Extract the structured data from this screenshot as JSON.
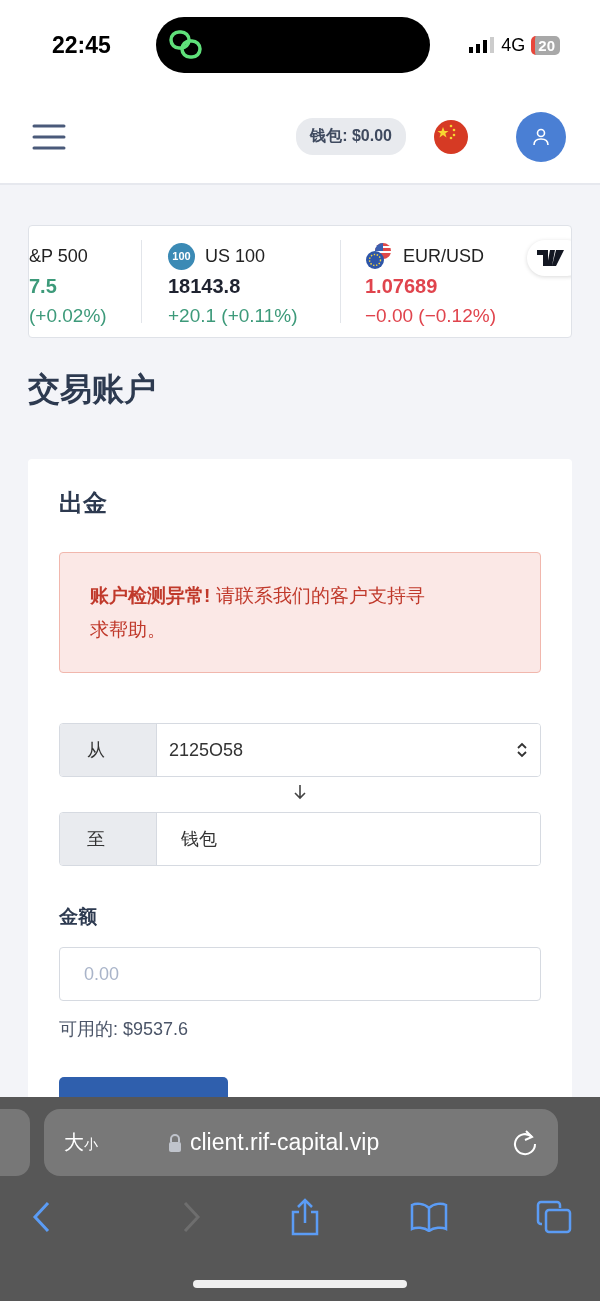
{
  "status_bar": {
    "time": "22:45",
    "network": "4G",
    "battery": "20"
  },
  "header": {
    "wallet": "钱包: $0.00"
  },
  "ticker": [
    {
      "kind": "cut",
      "name": "&P 500",
      "price": "7.5",
      "change": "(+0.02%)",
      "price_colored": true,
      "color": "#3d9a7a"
    },
    {
      "kind": "index",
      "badge": "100",
      "name": "US 100",
      "price": "18143.8",
      "change": "+20.1 (+0.11%)",
      "price_colored": false,
      "color": "#3d9a7a"
    },
    {
      "kind": "forex",
      "name": "EUR/USD",
      "price": "1.07689",
      "change": "−0.00 (−0.12%)",
      "price_colored": true,
      "color": "#e0444d"
    }
  ],
  "page_title": "交易账户",
  "card": {
    "title": "出金",
    "alert": "**账户检测异常!** 请联系我们的客户支持寻求帮助。",
    "from": {
      "label": "从",
      "value": "2125O58"
    },
    "to": {
      "label": "至",
      "value": "钱包"
    },
    "amount": {
      "label": "金额",
      "placeholder": "0.00"
    },
    "available": "可用的: $9537.6"
  },
  "browser": {
    "text_size": {
      "big": "大",
      "small": "小"
    },
    "url": "client.rif-capital.vip"
  }
}
